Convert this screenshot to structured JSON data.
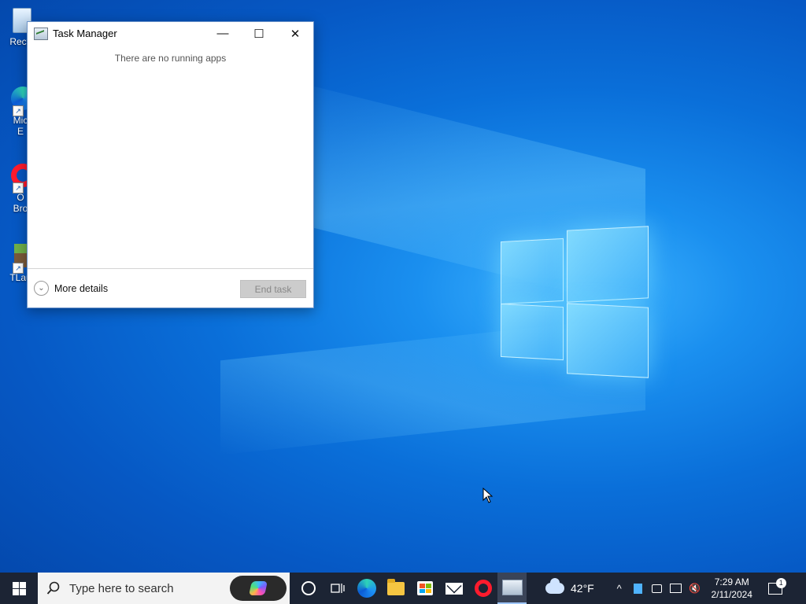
{
  "desktop": {
    "icons": [
      {
        "label": "Recy",
        "icon": "recycle-bin-icon"
      },
      {
        "label": "Mic\nE",
        "icon": "edge-shortcut-icon"
      },
      {
        "label": "O\nBro",
        "icon": "opera-shortcut-icon"
      },
      {
        "label": "TLau",
        "icon": "tlauncher-shortcut-icon"
      }
    ]
  },
  "window": {
    "title": "Task Manager",
    "minimize_glyph": "—",
    "maximize_glyph": "☐",
    "close_glyph": "✕",
    "empty_message": "There are no running apps",
    "more_details_label": "More details",
    "end_task_label": "End task"
  },
  "taskbar": {
    "search_placeholder": "Type here to search",
    "weather_temp": "42°F",
    "clock_time": "7:29 AM",
    "clock_date": "2/11/2024",
    "notification_count": "1",
    "pinned": [
      "cortana-icon",
      "task-view-icon",
      "edge-icon",
      "file-explorer-icon",
      "store-icon",
      "mail-icon",
      "opera-icon",
      "task-manager-icon"
    ]
  },
  "colors": {
    "taskbar_bg": "#1c2434",
    "desktop_accent": "#0a6fd9"
  }
}
